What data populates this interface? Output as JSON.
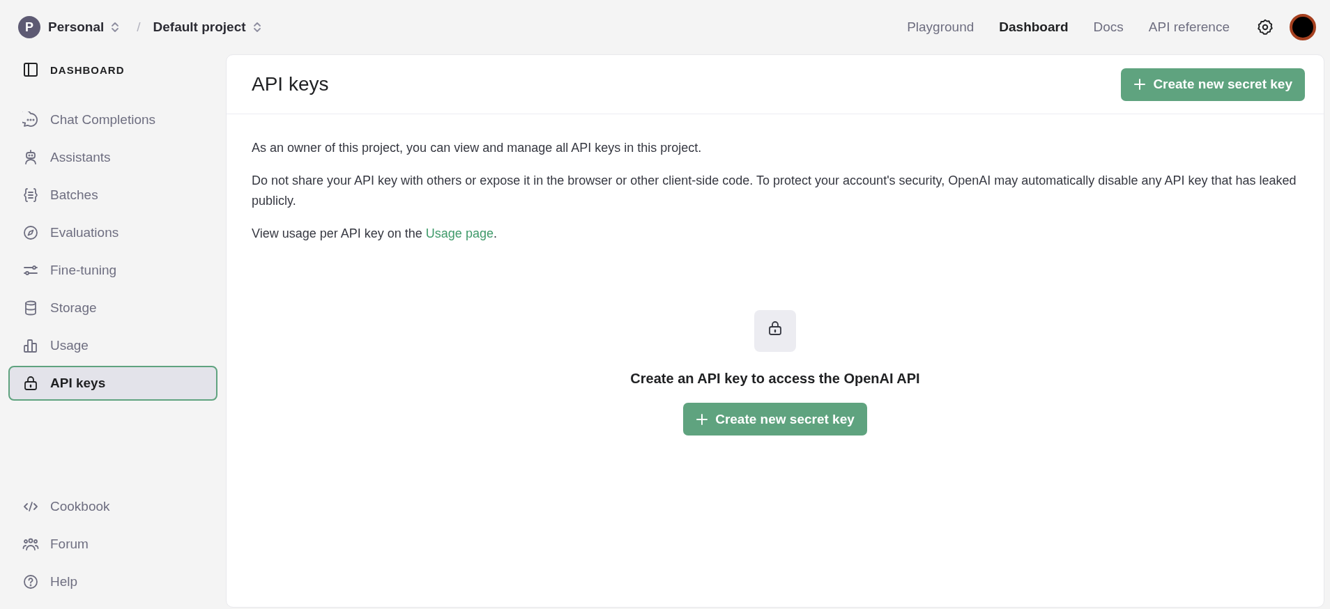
{
  "top_bar": {
    "org": {
      "avatar_letter": "P",
      "name": "Personal"
    },
    "separator": "/",
    "project": "Default project",
    "nav": [
      {
        "label": "Playground",
        "selected": false
      },
      {
        "label": "Dashboard",
        "selected": true
      },
      {
        "label": "Docs",
        "selected": false
      },
      {
        "label": "API reference",
        "selected": false
      }
    ]
  },
  "sidebar": {
    "title": "DASHBOARD",
    "items": [
      {
        "label": "Chat Completions",
        "selected": false
      },
      {
        "label": "Assistants",
        "selected": false
      },
      {
        "label": "Batches",
        "selected": false
      },
      {
        "label": "Evaluations",
        "selected": false
      },
      {
        "label": "Fine-tuning",
        "selected": false
      },
      {
        "label": "Storage",
        "selected": false
      },
      {
        "label": "Usage",
        "selected": false
      },
      {
        "label": "API keys",
        "selected": true
      }
    ],
    "footer_items": [
      {
        "label": "Cookbook"
      },
      {
        "label": "Forum"
      },
      {
        "label": "Help"
      }
    ]
  },
  "main": {
    "title": "API keys",
    "header_button": "Create new secret key",
    "paragraphs": [
      "As an owner of this project, you can view and manage all API keys in this project.",
      "Do not share your API key with others or expose it in the browser or other client-side code. To protect your account's security, OpenAI may automatically disable any API key that has leaked publicly."
    ],
    "usage_note": {
      "text": "View usage per API key on the ",
      "link": "Usage page",
      "after": "."
    },
    "empty_state": {
      "message": "Create an API key to access the OpenAI API",
      "button": "Create new secret key"
    }
  }
}
